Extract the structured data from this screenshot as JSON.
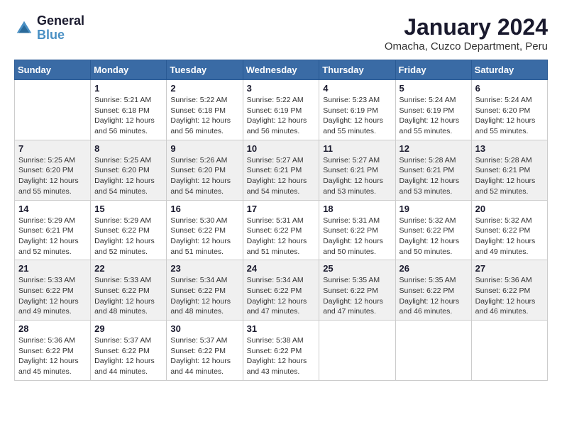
{
  "logo": {
    "text_general": "General",
    "text_blue": "Blue"
  },
  "header": {
    "title": "January 2024",
    "subtitle": "Omacha, Cuzco Department, Peru"
  },
  "calendar": {
    "days_of_week": [
      "Sunday",
      "Monday",
      "Tuesday",
      "Wednesday",
      "Thursday",
      "Friday",
      "Saturday"
    ],
    "weeks": [
      [
        {
          "day": "",
          "info": ""
        },
        {
          "day": "1",
          "info": "Sunrise: 5:21 AM\nSunset: 6:18 PM\nDaylight: 12 hours\nand 56 minutes."
        },
        {
          "day": "2",
          "info": "Sunrise: 5:22 AM\nSunset: 6:18 PM\nDaylight: 12 hours\nand 56 minutes."
        },
        {
          "day": "3",
          "info": "Sunrise: 5:22 AM\nSunset: 6:19 PM\nDaylight: 12 hours\nand 56 minutes."
        },
        {
          "day": "4",
          "info": "Sunrise: 5:23 AM\nSunset: 6:19 PM\nDaylight: 12 hours\nand 55 minutes."
        },
        {
          "day": "5",
          "info": "Sunrise: 5:24 AM\nSunset: 6:19 PM\nDaylight: 12 hours\nand 55 minutes."
        },
        {
          "day": "6",
          "info": "Sunrise: 5:24 AM\nSunset: 6:20 PM\nDaylight: 12 hours\nand 55 minutes."
        }
      ],
      [
        {
          "day": "7",
          "info": "Sunrise: 5:25 AM\nSunset: 6:20 PM\nDaylight: 12 hours\nand 55 minutes."
        },
        {
          "day": "8",
          "info": "Sunrise: 5:25 AM\nSunset: 6:20 PM\nDaylight: 12 hours\nand 54 minutes."
        },
        {
          "day": "9",
          "info": "Sunrise: 5:26 AM\nSunset: 6:20 PM\nDaylight: 12 hours\nand 54 minutes."
        },
        {
          "day": "10",
          "info": "Sunrise: 5:27 AM\nSunset: 6:21 PM\nDaylight: 12 hours\nand 54 minutes."
        },
        {
          "day": "11",
          "info": "Sunrise: 5:27 AM\nSunset: 6:21 PM\nDaylight: 12 hours\nand 53 minutes."
        },
        {
          "day": "12",
          "info": "Sunrise: 5:28 AM\nSunset: 6:21 PM\nDaylight: 12 hours\nand 53 minutes."
        },
        {
          "day": "13",
          "info": "Sunrise: 5:28 AM\nSunset: 6:21 PM\nDaylight: 12 hours\nand 52 minutes."
        }
      ],
      [
        {
          "day": "14",
          "info": "Sunrise: 5:29 AM\nSunset: 6:21 PM\nDaylight: 12 hours\nand 52 minutes."
        },
        {
          "day": "15",
          "info": "Sunrise: 5:29 AM\nSunset: 6:22 PM\nDaylight: 12 hours\nand 52 minutes."
        },
        {
          "day": "16",
          "info": "Sunrise: 5:30 AM\nSunset: 6:22 PM\nDaylight: 12 hours\nand 51 minutes."
        },
        {
          "day": "17",
          "info": "Sunrise: 5:31 AM\nSunset: 6:22 PM\nDaylight: 12 hours\nand 51 minutes."
        },
        {
          "day": "18",
          "info": "Sunrise: 5:31 AM\nSunset: 6:22 PM\nDaylight: 12 hours\nand 50 minutes."
        },
        {
          "day": "19",
          "info": "Sunrise: 5:32 AM\nSunset: 6:22 PM\nDaylight: 12 hours\nand 50 minutes."
        },
        {
          "day": "20",
          "info": "Sunrise: 5:32 AM\nSunset: 6:22 PM\nDaylight: 12 hours\nand 49 minutes."
        }
      ],
      [
        {
          "day": "21",
          "info": "Sunrise: 5:33 AM\nSunset: 6:22 PM\nDaylight: 12 hours\nand 49 minutes."
        },
        {
          "day": "22",
          "info": "Sunrise: 5:33 AM\nSunset: 6:22 PM\nDaylight: 12 hours\nand 48 minutes."
        },
        {
          "day": "23",
          "info": "Sunrise: 5:34 AM\nSunset: 6:22 PM\nDaylight: 12 hours\nand 48 minutes."
        },
        {
          "day": "24",
          "info": "Sunrise: 5:34 AM\nSunset: 6:22 PM\nDaylight: 12 hours\nand 47 minutes."
        },
        {
          "day": "25",
          "info": "Sunrise: 5:35 AM\nSunset: 6:22 PM\nDaylight: 12 hours\nand 47 minutes."
        },
        {
          "day": "26",
          "info": "Sunrise: 5:35 AM\nSunset: 6:22 PM\nDaylight: 12 hours\nand 46 minutes."
        },
        {
          "day": "27",
          "info": "Sunrise: 5:36 AM\nSunset: 6:22 PM\nDaylight: 12 hours\nand 46 minutes."
        }
      ],
      [
        {
          "day": "28",
          "info": "Sunrise: 5:36 AM\nSunset: 6:22 PM\nDaylight: 12 hours\nand 45 minutes."
        },
        {
          "day": "29",
          "info": "Sunrise: 5:37 AM\nSunset: 6:22 PM\nDaylight: 12 hours\nand 44 minutes."
        },
        {
          "day": "30",
          "info": "Sunrise: 5:37 AM\nSunset: 6:22 PM\nDaylight: 12 hours\nand 44 minutes."
        },
        {
          "day": "31",
          "info": "Sunrise: 5:38 AM\nSunset: 6:22 PM\nDaylight: 12 hours\nand 43 minutes."
        },
        {
          "day": "",
          "info": ""
        },
        {
          "day": "",
          "info": ""
        },
        {
          "day": "",
          "info": ""
        }
      ]
    ]
  }
}
